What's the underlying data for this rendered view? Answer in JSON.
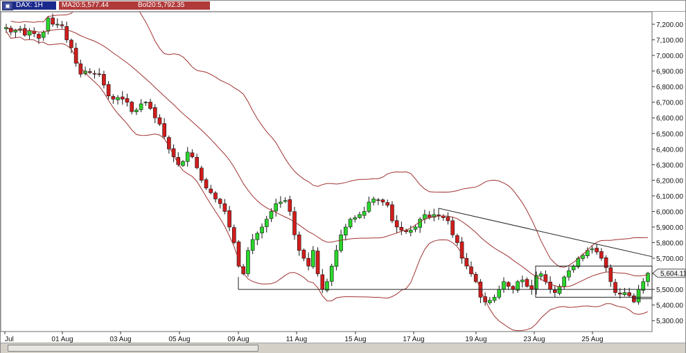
{
  "header": {
    "symbol": "DAX: 1H",
    "ma_label": "MA20:5,577.44",
    "bol_label": "Bol20:5,792.35",
    "ma_color": "#b03a3a",
    "bol_color": "#b03a3a"
  },
  "chart_data": {
    "type": "candlestick",
    "instrument": "DAX",
    "timeframe": "1H",
    "y_range": [
      5230,
      7280
    ],
    "y_ticks": [
      7200,
      7100,
      7000,
      6900,
      6800,
      6700,
      6600,
      6500,
      6400,
      6300,
      6200,
      6100,
      6000,
      5900,
      5800,
      5700,
      5600,
      5500,
      5400,
      5300
    ],
    "y_tick_labels": [
      "7,200.00",
      "7,100.00",
      "7,000.00",
      "6,900.00",
      "6,800.00",
      "6,700.00",
      "6,600.00",
      "6,500.00",
      "6,400.00",
      "6,300.00",
      "6,200.00",
      "6,100.00",
      "6,000.00",
      "5,900.00",
      "5,800.00",
      "5,700.00",
      "5,600.00",
      "5,500.00",
      "5,400.00",
      "5,300.00"
    ],
    "x_labels": [
      "Jul",
      "01 Aug",
      "03 Aug",
      "05 Aug",
      "09 Aug",
      "11 Aug",
      "15 Aug",
      "17 Aug",
      "19 Aug",
      "23 Aug",
      "25 Aug"
    ],
    "last_price_label": "5,604.11",
    "last_price": 5604.11,
    "up_color": "#2bd62b",
    "down_color": "#d41c1c",
    "band_color": "#a03030",
    "price_path": [
      7180,
      7150,
      7160,
      7170,
      7130,
      7160,
      7140,
      7110,
      7150,
      7240,
      7200,
      7200,
      7190,
      7100,
      7050,
      6950,
      6880,
      6900,
      6890,
      6880,
      6880,
      6810,
      6740,
      6720,
      6730,
      6720,
      6700,
      6640,
      6650,
      6690,
      6700,
      6660,
      6600,
      6560,
      6480,
      6400,
      6350,
      6300,
      6320,
      6380,
      6350,
      6280,
      6200,
      6150,
      6120,
      6080,
      6050,
      6000,
      5900,
      5800,
      5650,
      5600,
      5750,
      5820,
      5860,
      5900,
      5950,
      6000,
      6050,
      6060,
      6070,
      6000,
      5850,
      5750,
      5700,
      5650,
      5750,
      5600,
      5500,
      5550,
      5650,
      5750,
      5850,
      5900,
      5950,
      5960,
      5980,
      6000,
      6060,
      6080,
      6070,
      6060,
      6040,
      5940,
      5900,
      5880,
      5870,
      5880,
      5900,
      5950,
      5980,
      5960,
      5980,
      5970,
      5960,
      5940,
      5850,
      5800,
      5700,
      5650,
      5600,
      5550,
      5450,
      5420,
      5430,
      5450,
      5500,
      5550,
      5520,
      5500,
      5550,
      5560,
      5520,
      5500,
      5590,
      5600,
      5550,
      5500,
      5480,
      5520,
      5580,
      5620,
      5650,
      5700,
      5720,
      5750,
      5760,
      5740,
      5700,
      5640,
      5550,
      5480,
      5470,
      5480,
      5460,
      5420,
      5500,
      5550,
      5604
    ]
  },
  "scrollbar": {
    "label": "horizontal-scroll"
  }
}
